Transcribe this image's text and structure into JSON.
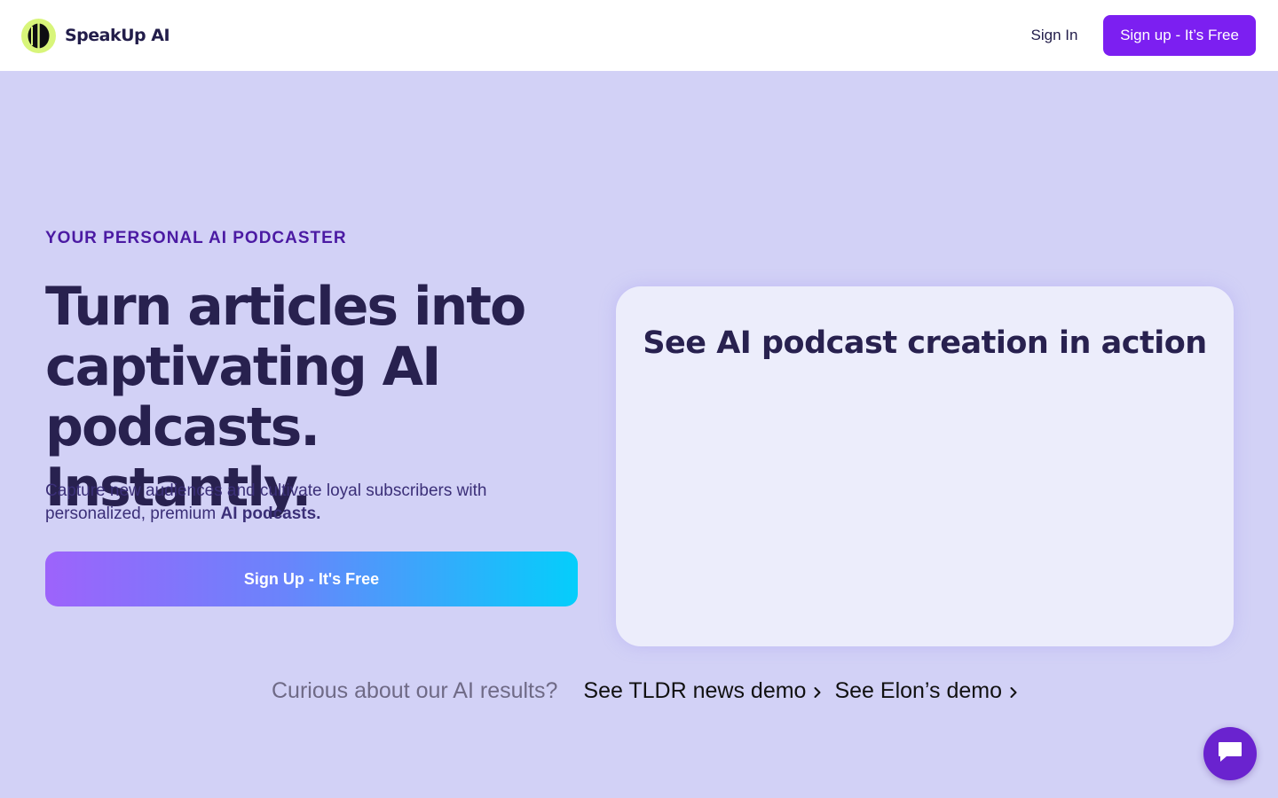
{
  "header": {
    "brand": "SpeakUp AI",
    "sign_in": "Sign In",
    "sign_up": "Sign up - It’s Free"
  },
  "hero": {
    "eyebrow": "YOUR PERSONAL AI PODCASTER",
    "title": "Turn articles into captivating AI podcasts. Instantly.",
    "subtitle_plain": "Capture new audiences and cultivate loyal subscribers with personalized, premium ",
    "subtitle_bold": "AI podcasts.",
    "cta": "Sign Up - It's Free"
  },
  "demo": {
    "title": "See AI podcast creation in action"
  },
  "results": {
    "prompt": "Curious about our AI results?",
    "links": [
      {
        "label": "See TLDR news demo"
      },
      {
        "label": "See Elon’s demo"
      }
    ]
  },
  "icons": {
    "logo": "speakup-logo-icon",
    "chevron": "chevron-right-icon",
    "chat": "chat-bubble-icon"
  },
  "colors": {
    "accent": "#7c1ff1",
    "background": "#d2d1f6",
    "logo_lime": "#d8f57a",
    "chat": "#6a23cf"
  }
}
